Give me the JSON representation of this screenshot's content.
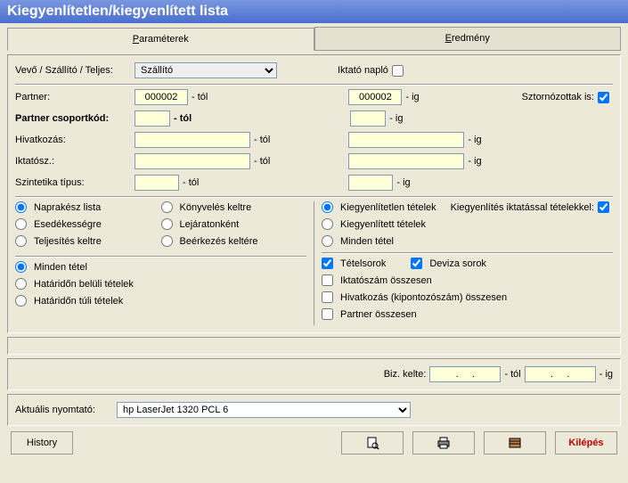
{
  "title": "Kiegyenlítetlen/kiegyenlített lista",
  "tabs": {
    "params": "Paraméterek",
    "result": "Eredmény"
  },
  "labels": {
    "entity": "Vevő / Szállító / Teljes:",
    "iktato": "Iktató napló",
    "partner": "Partner:",
    "csoportkod": "Partner csoportkód:",
    "hivatkozas": "Hivatkozás:",
    "iktatosz": "Iktatósz.:",
    "szintetika": "Szintetika típus:",
    "tol": "- tól",
    "ig": "- ig",
    "sztorno": "Sztornózottak is:",
    "bizkelte": "Biz. kelte:",
    "nyomtato": "Aktuális nyomtató:"
  },
  "entity_value": "Szállító",
  "partner_from": "000002",
  "partner_to": "000002",
  "date_from": ".     .",
  "date_to": ".     .",
  "radios1": {
    "naprakesz": "Naprakész lista",
    "esedek": "Esedékességre",
    "teljesites": "Teljesítés keltre",
    "konyveles": "Könyvelés keltre",
    "lejarat": "Lejáratonként",
    "beerkezes": "Beérkezés keltére"
  },
  "radios2": {
    "kiegyenlitetlen": "Kiegyenlítetlen tételek",
    "kiegyenlitett": "Kiegyenlített tételek",
    "minden": "Minden tétel"
  },
  "check_iktatassal": "Kiegyenlítés iktatással tételekkel:",
  "radios3": {
    "minden": "Minden tétel",
    "belul": "Határidőn belüli tételek",
    "tul": "Határidőn túli tételek"
  },
  "checks": {
    "tetelsorok": "Tételsorok",
    "deviza": "Deviza sorok",
    "iktatoszam": "Iktatószám összesen",
    "hivatkozas": "Hivatkozás (kipontozószám) összesen",
    "partner": "Partner összesen"
  },
  "printer": "hp LaserJet 1320 PCL 6",
  "buttons": {
    "history": "History",
    "exit": "Kilépés"
  }
}
